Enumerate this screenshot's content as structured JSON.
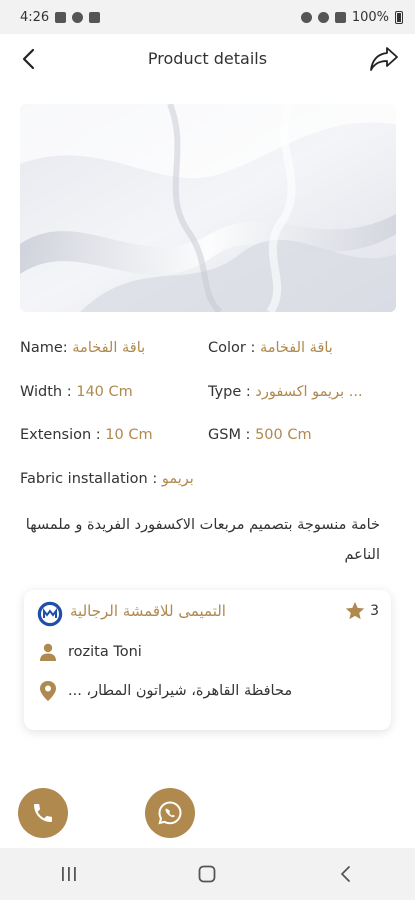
{
  "status_bar": {
    "time": "4:26",
    "battery": "100%"
  },
  "header": {
    "title": "Product details",
    "back_icon": "arrow-left-icon",
    "share_icon": "share-icon"
  },
  "product": {
    "name_label": "Name:",
    "name_value": "باقة الفخامة",
    "color_label": "Color :",
    "color_value": "باقة الفخامة",
    "width_label": "Width :",
    "width_value": "140 Cm",
    "type_label": "Type :",
    "type_value": "بريمو اكسفورد ...",
    "extension_label": "Extension :",
    "extension_value": "10 Cm",
    "gsm_label": "GSM :",
    "gsm_value": "500 Cm",
    "installation_label": "Fabric installation :",
    "installation_value": "بريمو",
    "description": "خامة منسوجة بتصميم مربعات الاكسفورد الفريدة و ملمسها الناعم"
  },
  "store": {
    "rating": "3",
    "name": "التميمى للاقمشة الرجالية",
    "owner": "rozita Toni",
    "address": "محافظة القاهرة، شيراتون المطار، ..."
  },
  "colors": {
    "accent": "#b0894e",
    "text": "#333333",
    "nav_bg": "#f2f2f2"
  }
}
